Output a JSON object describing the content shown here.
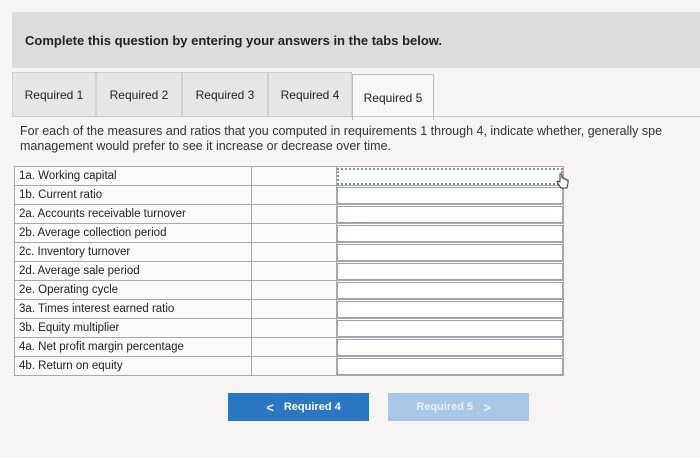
{
  "instruction": "Complete this question by entering your answers in the tabs below.",
  "tabs": [
    {
      "label": "Required 1",
      "active": false
    },
    {
      "label": "Required 2",
      "active": false
    },
    {
      "label": "Required 3",
      "active": false
    },
    {
      "label": "Required 4",
      "active": false
    },
    {
      "label": "Required 5",
      "active": true
    }
  ],
  "prompt": "For each of the measures and ratios that you computed in requirements 1 through 4, indicate whether, generally spe",
  "prompt_line2": "management would prefer to see it increase or decrease over time.",
  "rows": [
    {
      "label": "1a. Working capital",
      "answer": ""
    },
    {
      "label": "1b. Current ratio",
      "answer": ""
    },
    {
      "label": "2a. Accounts receivable turnover",
      "answer": ""
    },
    {
      "label": "2b. Average collection period",
      "answer": ""
    },
    {
      "label": "2c. Inventory turnover",
      "answer": ""
    },
    {
      "label": "2d. Average sale period",
      "answer": ""
    },
    {
      "label": "2e. Operating cycle",
      "answer": ""
    },
    {
      "label": "3a. Times interest earned ratio",
      "answer": ""
    },
    {
      "label": "3b. Equity multiplier",
      "answer": ""
    },
    {
      "label": "4a. Net profit margin percentage",
      "answer": ""
    },
    {
      "label": "4b. Return on equity",
      "answer": ""
    }
  ],
  "nav": {
    "prev_label": "Required 4",
    "prev_chevron": "<",
    "next_label": "Required 5",
    "next_chevron": ">"
  },
  "colors": {
    "primary_button": "#2b77c3",
    "disabled_button": "#a8c6e6"
  }
}
